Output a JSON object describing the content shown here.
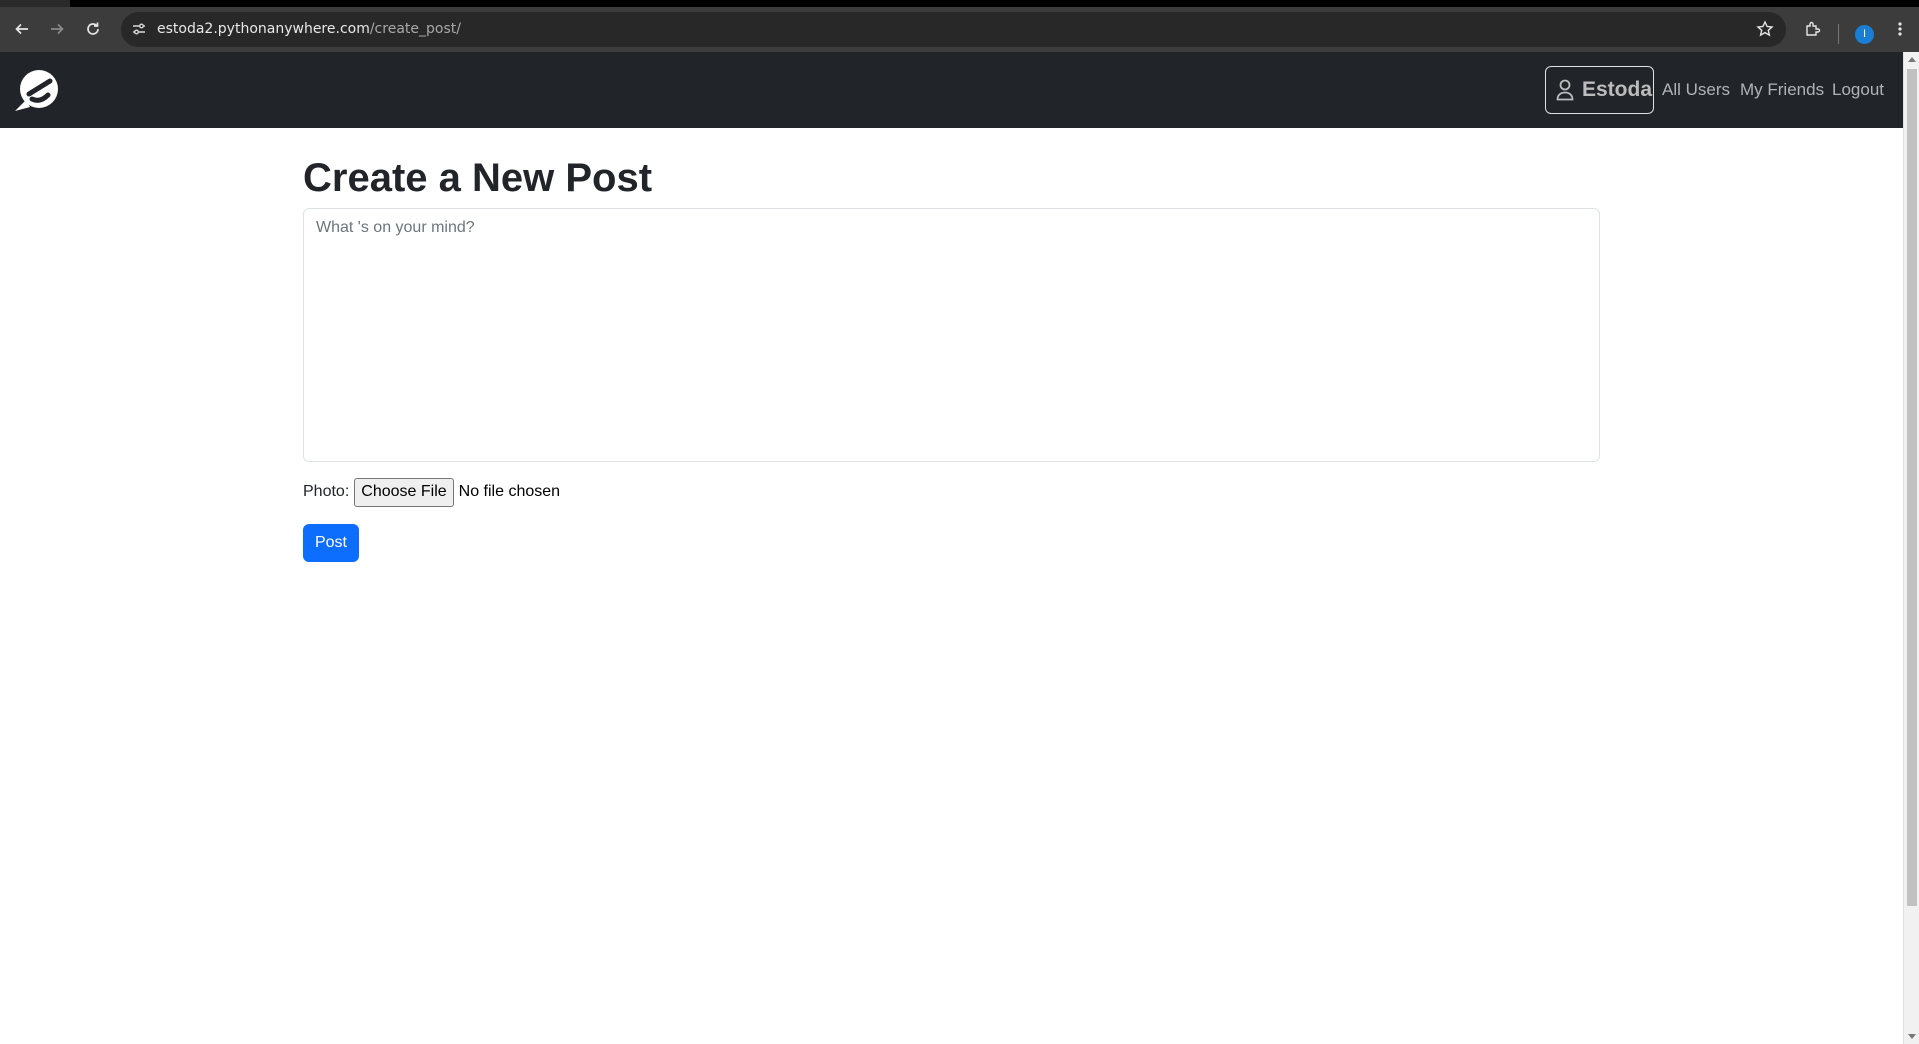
{
  "browser": {
    "url_host": "estoda2.pythonanywhere.com",
    "url_path": "/create_post/",
    "profile_initial": "I"
  },
  "navbar": {
    "brand_icon": "e-logo-icon",
    "profile_name": "Estoda",
    "links": {
      "all_users": "All Users",
      "my_friends": "My Friends",
      "logout": "Logout"
    }
  },
  "main": {
    "title": "Create a New Post",
    "textarea_placeholder": "What 's on your mind?",
    "textarea_value": "",
    "photo_label": "Photo:",
    "file_button": "Choose File",
    "file_status": "No file chosen",
    "submit_label": "Post"
  },
  "colors": {
    "navbar_bg": "#212529",
    "primary": "#0d6efd"
  }
}
